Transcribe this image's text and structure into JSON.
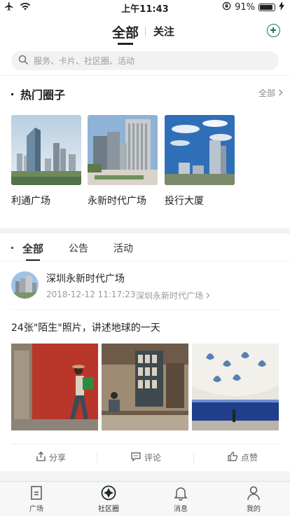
{
  "status_bar": {
    "time": "上午11:43",
    "battery_percent": "91%",
    "battery_level": 0.91,
    "icons": [
      "airplane-icon",
      "wifi-icon",
      "rotation-lock-icon",
      "battery-icon",
      "charging-icon"
    ]
  },
  "nav": {
    "tab_all": "全部",
    "tab_follow": "关注",
    "add_icon": "plus-circle-icon",
    "accent_color": "#1d7a45"
  },
  "search": {
    "placeholder": "服务、卡片、社区圈、活动"
  },
  "hot_circles": {
    "title": "热门圈子",
    "all_label": "全部",
    "items": [
      {
        "name": "利通广场"
      },
      {
        "name": "永新时代广场"
      },
      {
        "name": "投行大厦"
      }
    ]
  },
  "feed_tabs": {
    "items": [
      "全部",
      "公告",
      "活动"
    ],
    "active_index": 0
  },
  "post": {
    "author": "深圳永新时代广场",
    "time": "2018-12-12 11:17:23",
    "source": "深圳永新时代广场",
    "text": "24张\"陌生\"照片，讲述地球的一天",
    "actions": {
      "share": "分享",
      "comment": "评论",
      "like": "点赞"
    }
  },
  "tabbar": {
    "items": [
      {
        "label": "广场",
        "icon": "plaza-icon"
      },
      {
        "label": "社区圈",
        "icon": "community-circle-icon"
      },
      {
        "label": "消息",
        "icon": "bell-icon"
      },
      {
        "label": "我的",
        "icon": "person-icon"
      }
    ],
    "active_index": 1
  }
}
